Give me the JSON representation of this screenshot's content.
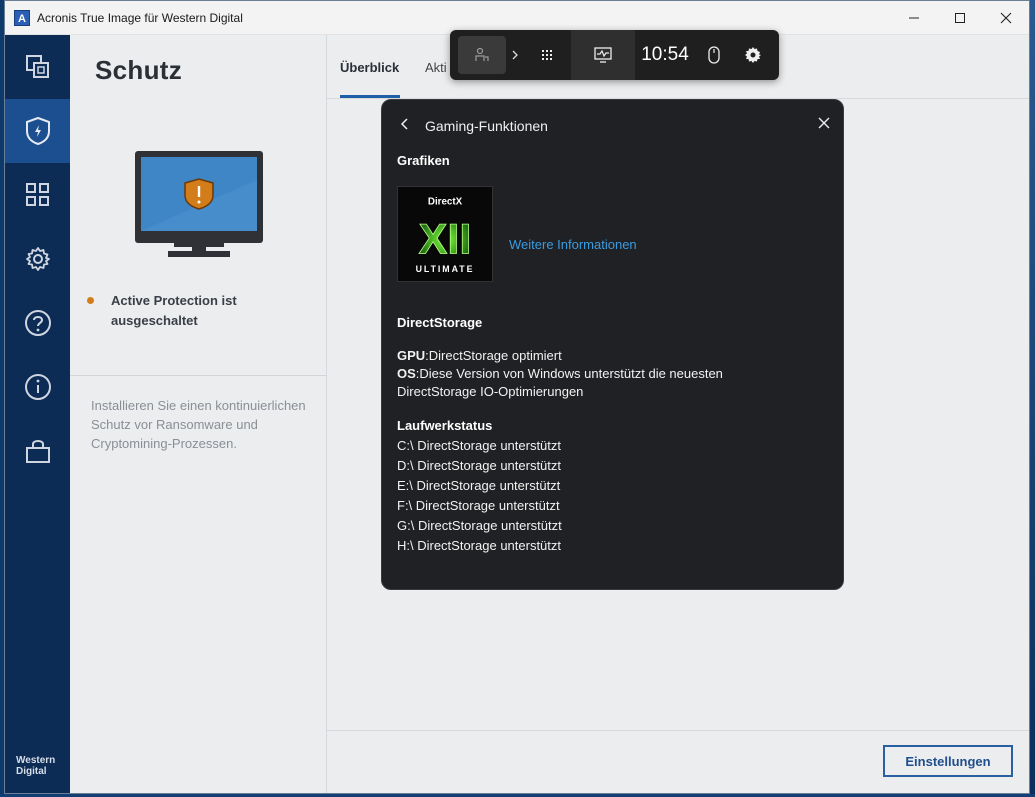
{
  "window": {
    "title": "Acronis True Image für Western Digital",
    "logo_letter": "A"
  },
  "sidebar": {
    "items": [
      {
        "icon": "copy-icon"
      },
      {
        "icon": "shield-icon"
      },
      {
        "icon": "grid-icon"
      },
      {
        "icon": "gear-icon"
      },
      {
        "icon": "help-icon"
      },
      {
        "icon": "info-icon"
      },
      {
        "icon": "bag-icon"
      }
    ],
    "brand_line1": "Western",
    "brand_line2": "Digital"
  },
  "left_panel": {
    "title": "Schutz",
    "status": "Active Protection ist ausgeschaltet",
    "description": "Installieren Sie einen kontinuierlichen Schutz vor Ransomware und Cryptomining-Prozessen."
  },
  "main": {
    "tabs": [
      {
        "label": "Überblick",
        "active": true
      },
      {
        "label": "Akti",
        "active": false
      }
    ],
    "settings_button": "Einstellungen"
  },
  "gamebar": {
    "time": "10:54"
  },
  "gaming_panel": {
    "title": "Gaming-Funktionen",
    "graphics_heading": "Grafiken",
    "directx_brand": "DirectX",
    "directx_version": "XII",
    "directx_edition": "ULTIMATE",
    "more_info_link": "Weitere Informationen",
    "directstorage_heading": "DirectStorage",
    "gpu_label": "GPU",
    "gpu_value": ":DirectStorage optimiert",
    "os_label": "OS",
    "os_value": ":Diese Version von Windows unterstützt die neuesten",
    "os_value_line2": "DirectStorage IO-Optimierungen",
    "drive_heading": "Laufwerkstatus",
    "drives": [
      "C:\\ DirectStorage unterstützt",
      "D:\\ DirectStorage unterstützt",
      "E:\\ DirectStorage unterstützt",
      "F:\\ DirectStorage unterstützt",
      "G:\\ DirectStorage unterstützt",
      "H:\\ DirectStorage unterstützt"
    ]
  },
  "colors": {
    "sidebar_bg": "#0c2b55",
    "sidebar_active": "#1c4f8f",
    "accent": "#1f5fa8",
    "status_warning": "#d27d1a",
    "link": "#3a9be0",
    "panel_bg": "#202124"
  }
}
